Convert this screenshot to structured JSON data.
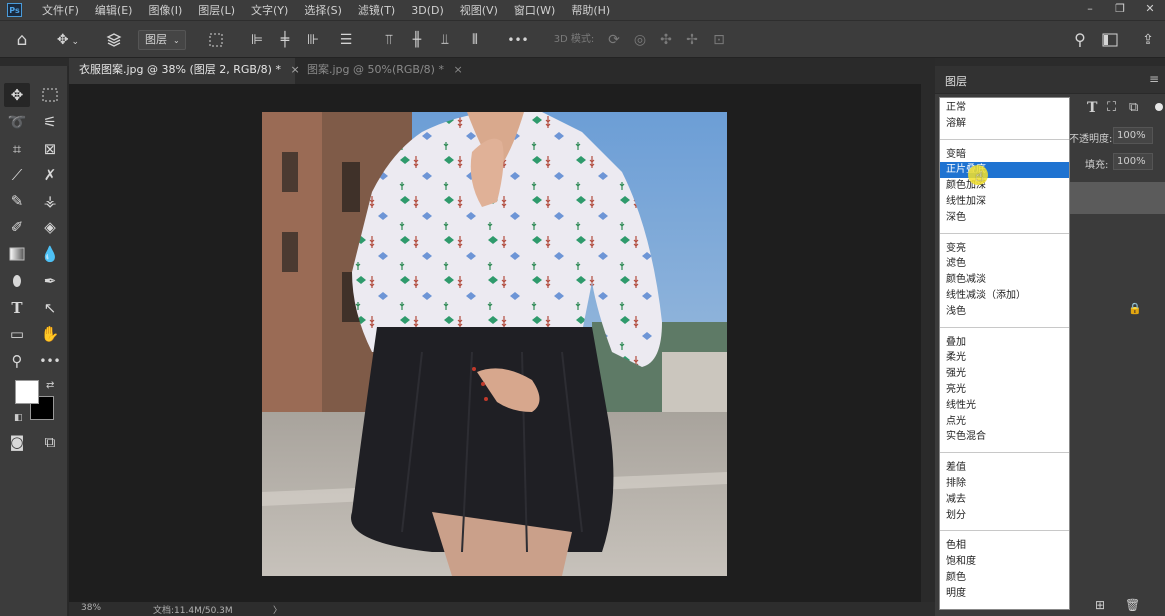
{
  "menu": {
    "logo": "Ps",
    "items": [
      "文件(F)",
      "编辑(E)",
      "图像(I)",
      "图层(L)",
      "文字(Y)",
      "选择(S)",
      "滤镜(T)",
      "3D(D)",
      "视图(V)",
      "窗口(W)",
      "帮助(H)"
    ],
    "window_controls": [
      "–",
      "❐",
      "✕"
    ]
  },
  "options": {
    "layer_select": "图层",
    "mode_3d": "3D 模式:",
    "more": "•••"
  },
  "tabs": [
    {
      "label": "衣服图案.jpg @ 38% (图层 2, RGB/8) *",
      "close": "×",
      "active": true
    },
    {
      "label": "图案.jpg @ 50%(RGB/8) *",
      "close": "×",
      "active": false
    }
  ],
  "status": {
    "zoom": "38%",
    "doc": "文档:11.4M/50.3M",
    "arrow": "〉"
  },
  "layers_panel": {
    "title": "图层",
    "opacity_label": "不透明度:",
    "opacity_value": "100%",
    "fill_label": "填充:",
    "fill_value": "100%"
  },
  "blend_modes": [
    [
      "正常",
      "溶解"
    ],
    [
      "变暗",
      "正片叠底",
      "颜色加深",
      "线性加深",
      "深色"
    ],
    [
      "变亮",
      "滤色",
      "颜色减淡",
      "线性减淡（添加）",
      "浅色"
    ],
    [
      "叠加",
      "柔光",
      "强光",
      "亮光",
      "线性光",
      "点光",
      "实色混合"
    ],
    [
      "差值",
      "排除",
      "减去",
      "划分"
    ],
    [
      "色相",
      "饱和度",
      "颜色",
      "明度"
    ]
  ],
  "selected_mode": "正片叠底",
  "colors": {
    "accent": "#1f73d1",
    "cursor": "#f2e12b",
    "background": "#282828"
  }
}
